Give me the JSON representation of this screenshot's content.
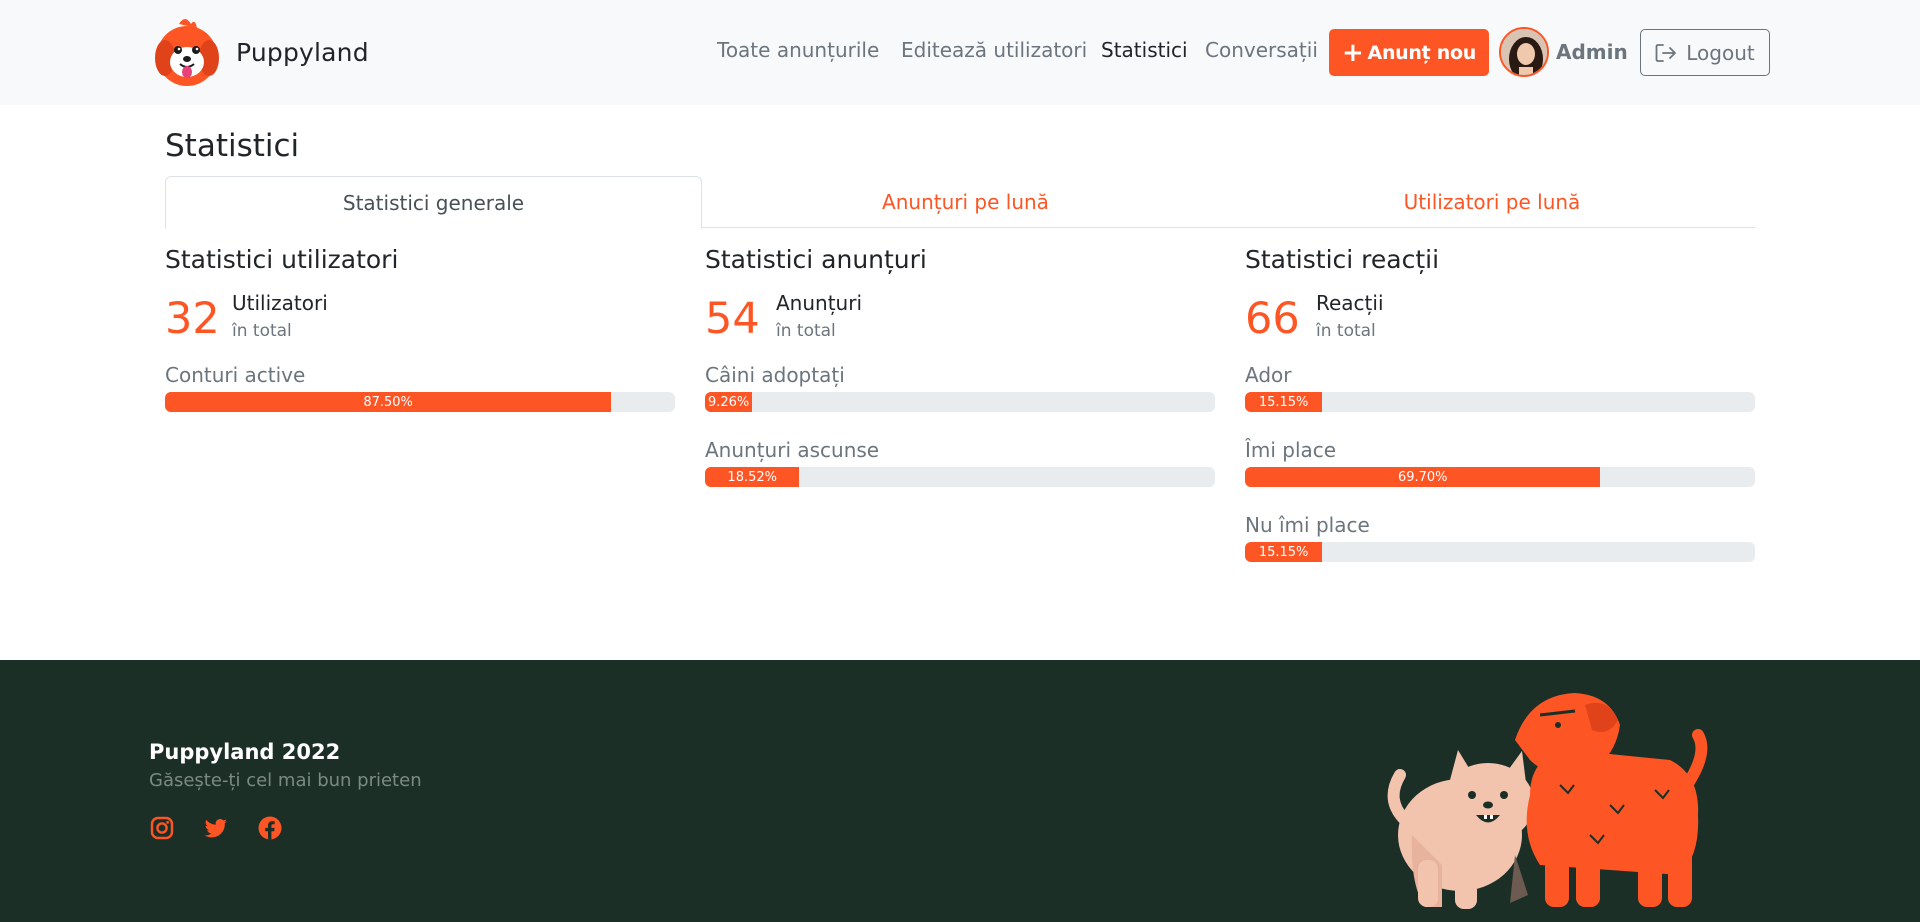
{
  "brand": {
    "name": "Puppyland"
  },
  "nav": {
    "links": [
      "Toate anunțurile",
      "Editează utilizatori",
      "Statistici",
      "Conversații"
    ],
    "new_button": "Anunț nou",
    "user_name": "Admin",
    "logout": "Logout"
  },
  "page": {
    "title": "Statistici"
  },
  "tabs": [
    "Statistici generale",
    "Anunțuri pe lună",
    "Utilizatori pe lună"
  ],
  "columns": [
    {
      "title": "Statistici utilizatori",
      "total": "32",
      "total_label": "Utilizatori",
      "total_sub": "în total",
      "metrics": [
        {
          "label": "Conturi active",
          "value": "87.50%",
          "percent": 87.5
        }
      ]
    },
    {
      "title": "Statistici anunțuri",
      "total": "54",
      "total_label": "Anunțuri",
      "total_sub": "în total",
      "metrics": [
        {
          "label": "Câini adoptați",
          "value": "9.26%",
          "percent": 9.26
        },
        {
          "label": "Anunțuri ascunse",
          "value": "18.52%",
          "percent": 18.52
        }
      ]
    },
    {
      "title": "Statistici reacții",
      "total": "66",
      "total_label": "Reacții",
      "total_sub": "în total",
      "metrics": [
        {
          "label": "Ador",
          "value": "15.15%",
          "percent": 15.15
        },
        {
          "label": "Îmi place",
          "value": "69.70%",
          "percent": 69.7
        },
        {
          "label": "Nu îmi place",
          "value": "15.15%",
          "percent": 15.15
        }
      ]
    }
  ],
  "footer": {
    "title": "Puppyland 2022",
    "subtitle": "Găsește-ți cel mai bun prieten",
    "socials": [
      "instagram-icon",
      "twitter-icon",
      "facebook-icon"
    ]
  },
  "colors": {
    "accent": "#fd5523",
    "footer_bg": "#1b2f27",
    "navbar_bg": "#f8f9fa"
  }
}
